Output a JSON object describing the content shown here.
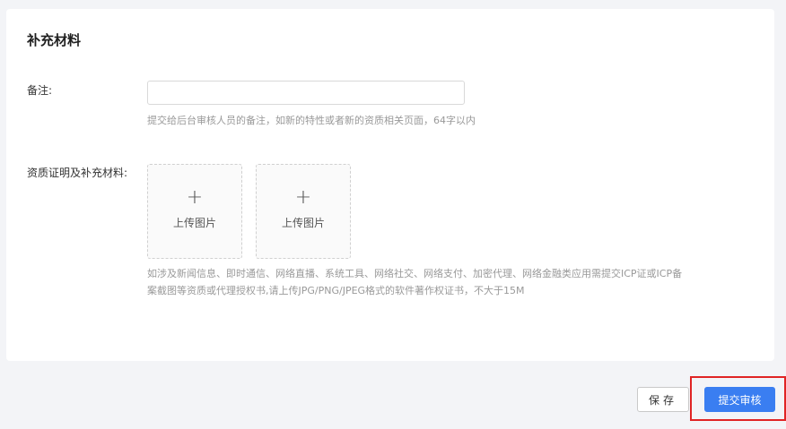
{
  "section": {
    "title": "补充材料"
  },
  "remark": {
    "label": "备注:",
    "value": "",
    "placeholder": "",
    "hint": "提交给后台审核人员的备注，如新的特性或者新的资质相关页面，64字以内"
  },
  "proof": {
    "label": "资质证明及补充材料:",
    "uploads": [
      {
        "icon": "plus-icon",
        "plus": "+",
        "label": "上传图片"
      },
      {
        "icon": "plus-icon",
        "plus": "+",
        "label": "上传图片"
      }
    ],
    "hint": "如涉及新闻信息、即时通信、网络直播、系统工具、网络社交、网络支付、加密代理、网络金融类应用需提交ICP证或ICP备案截图等资质或代理授权书,请上传JPG/PNG/JPEG格式的软件著作权证书，不大于15M"
  },
  "actions": {
    "save_label": "保存",
    "submit_label": "提交审核",
    "highlight_color": "#e02424",
    "primary_color": "#3a7ef1"
  }
}
